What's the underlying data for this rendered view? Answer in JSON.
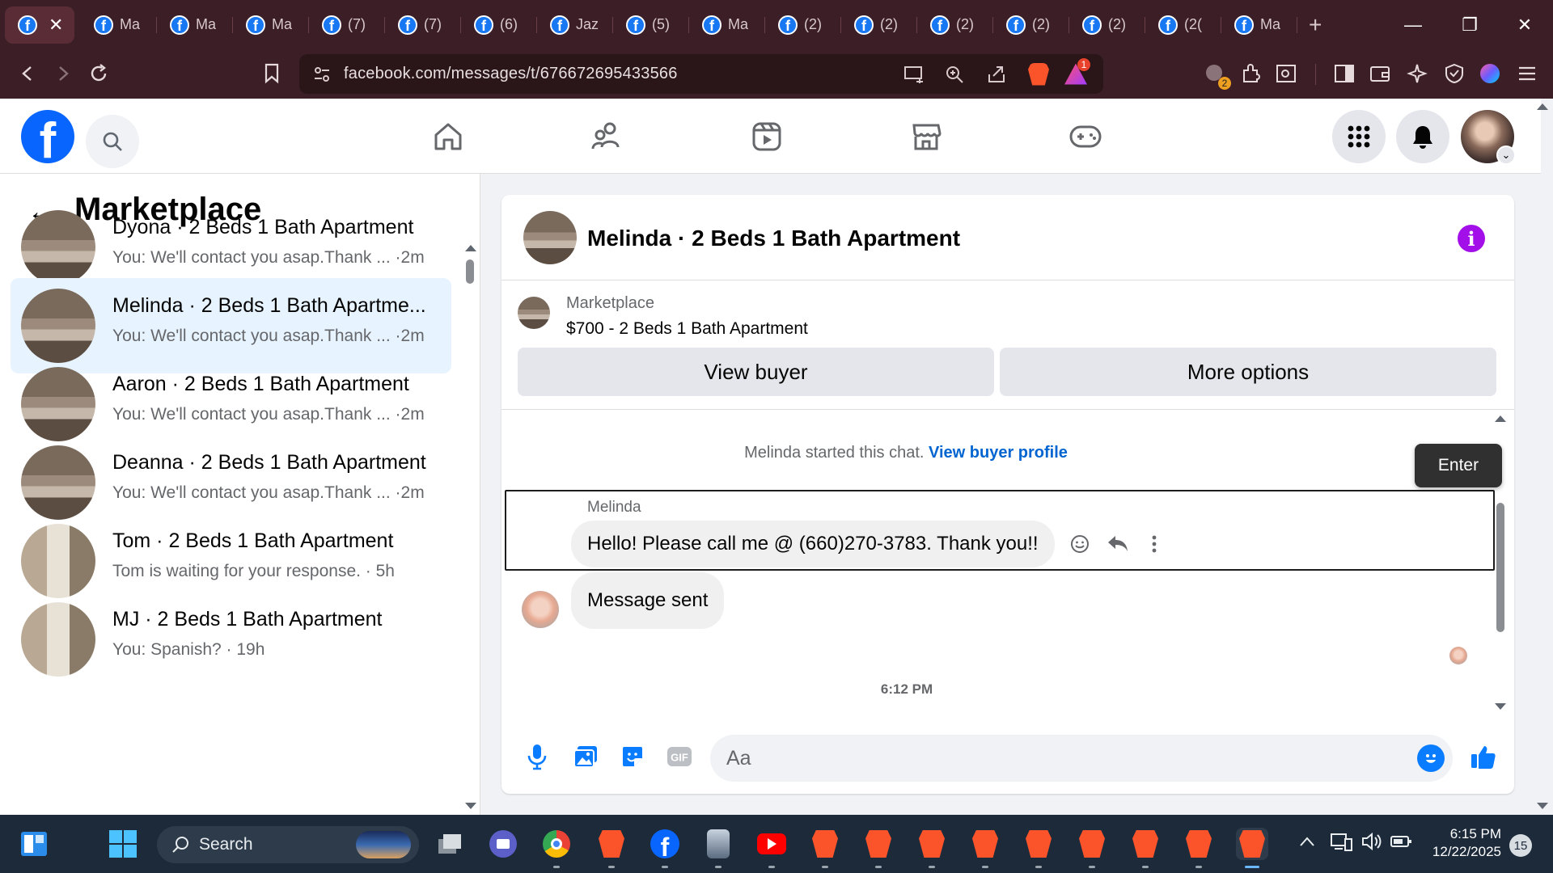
{
  "browser": {
    "tabs": [
      {
        "label": "",
        "active": true
      },
      {
        "label": "Ma"
      },
      {
        "label": "Ma"
      },
      {
        "label": "Ma"
      },
      {
        "label": "(7)"
      },
      {
        "label": "(7)"
      },
      {
        "label": "(6)"
      },
      {
        "label": "Jaz"
      },
      {
        "label": "(5)"
      },
      {
        "label": "Ma"
      },
      {
        "label": "(2)"
      },
      {
        "label": "(2)"
      },
      {
        "label": "(2)"
      },
      {
        "label": "(2)"
      },
      {
        "label": "(2)"
      },
      {
        "label": "(2("
      },
      {
        "label": "Ma"
      }
    ],
    "url": "facebook.com/messages/t/676672695433566",
    "rewards_badge": "1",
    "ext_badge": "2"
  },
  "left_panel": {
    "title": "Marketplace",
    "conversations": [
      {
        "name": "Dyona · 2 Beds 1 Bath Apartment",
        "preview": "You: We'll contact you asap.Thank ... ·2m",
        "thumb": "room"
      },
      {
        "name": "Melinda · 2 Beds 1 Bath Apartme...",
        "preview": "You: We'll contact you asap.Thank ... ·2m",
        "thumb": "room",
        "selected": true
      },
      {
        "name": "Aaron · 2 Beds 1 Bath Apartment",
        "preview": "You: We'll contact you asap.Thank ... ·2m",
        "thumb": "room"
      },
      {
        "name": "Deanna · 2 Beds 1 Bath Apartment",
        "preview": "You: We'll contact you asap.Thank ... ·2m",
        "thumb": "room"
      },
      {
        "name": "Tom · 2 Beds 1 Bath Apartment",
        "preview": "Tom is waiting for your response. · 5h",
        "thumb": "room2"
      },
      {
        "name": "MJ · 2 Beds 1 Bath Apartment",
        "preview": "You: Spanish? · 19h",
        "thumb": "room2"
      }
    ]
  },
  "chat": {
    "title": "Melinda · 2 Beds 1 Bath Apartment",
    "listing": {
      "label": "Marketplace",
      "title": "$700 - 2 Beds 1 Bath Apartment",
      "view_buyer": "View buyer",
      "more_options": "More options"
    },
    "started_text": "Melinda started this chat.",
    "view_buyer_profile": "View buyer profile",
    "enter_tooltip": "Enter",
    "sender": "Melinda",
    "message_1": "Hello! Please call me @ (660)270-3783. Thank you!!",
    "message_2": "Message sent",
    "timestamp": "6:12 PM",
    "composer_placeholder": "Aa"
  },
  "taskbar": {
    "search_label": "Search",
    "time": "6:15 PM",
    "date": "12/22/2025",
    "notifications": "15"
  },
  "colors": {
    "fb_blue": "#0866ff",
    "selected_bg": "#e7f3ff",
    "chrome_bg": "#3c1f26",
    "info_purple": "#a20fe8",
    "link": "#0064d1"
  }
}
